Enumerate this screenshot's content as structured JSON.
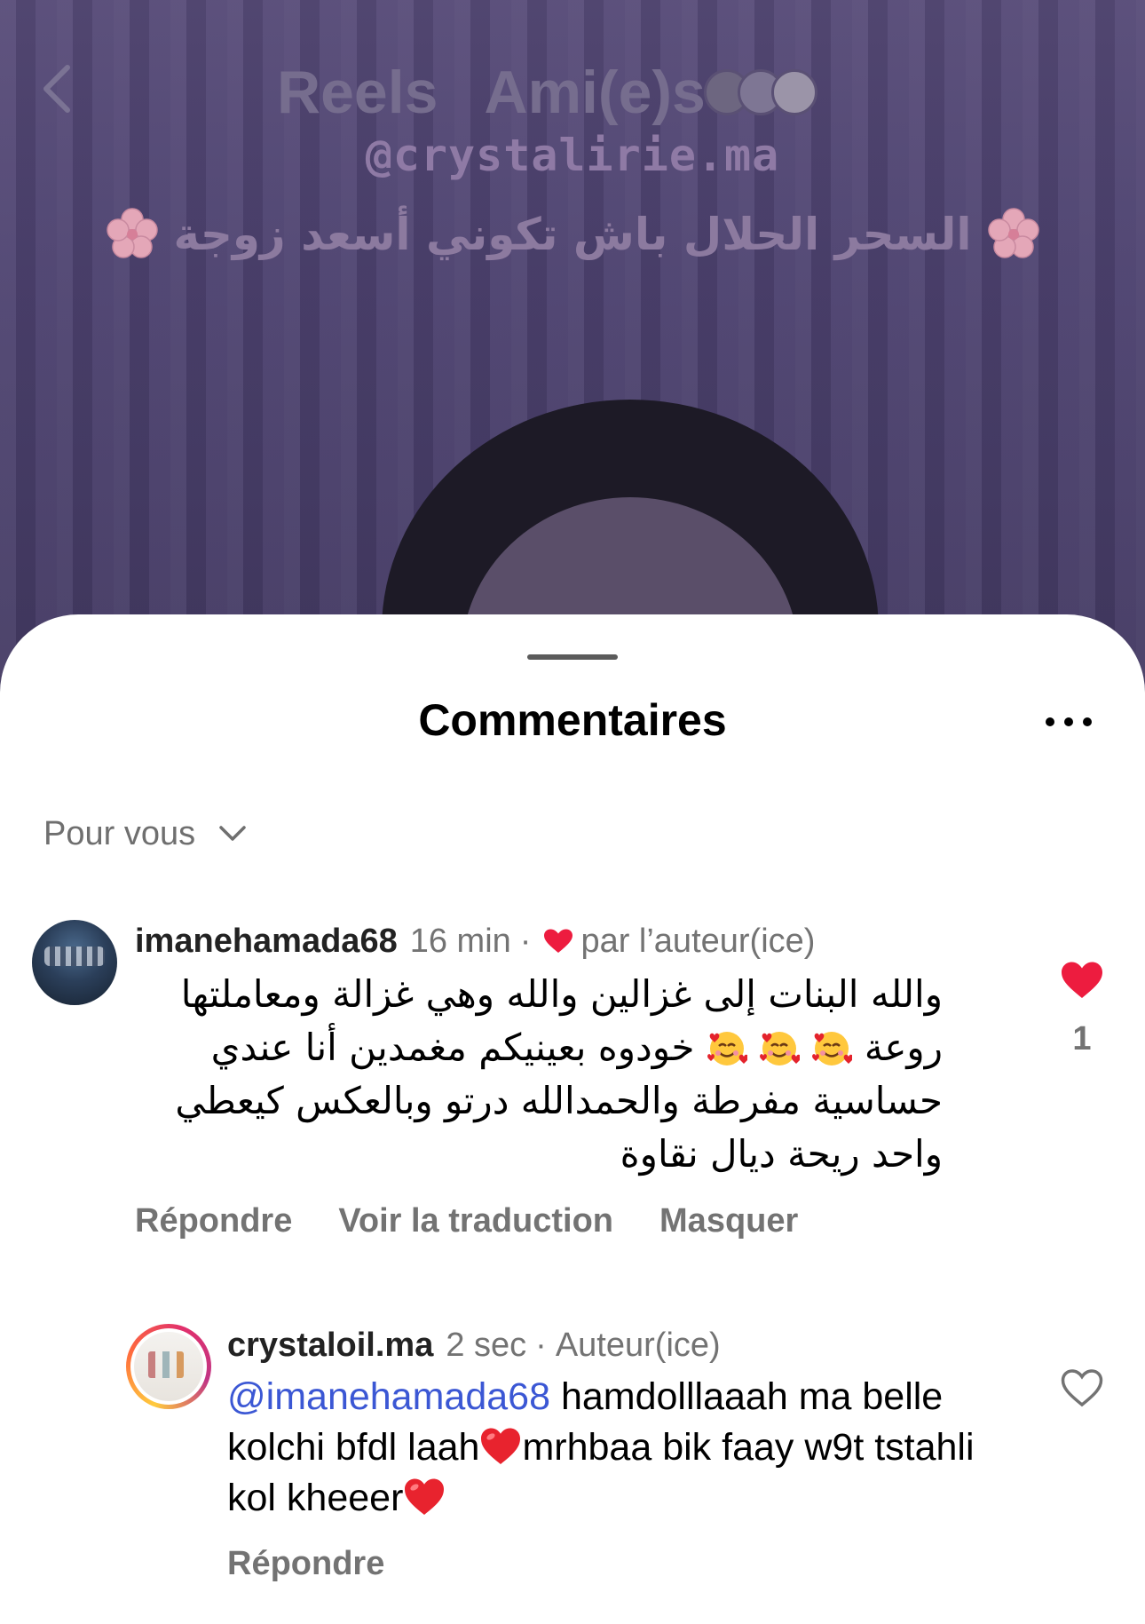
{
  "reel": {
    "tabs": [
      "Reels",
      "Ami(e)s"
    ],
    "overlay_handle": "@crystalirie.ma",
    "overlay_text": "السحر الحلال باش تكوني أسعد زوجة"
  },
  "sheet": {
    "title": "Commentaires",
    "filter_label": "Pour vous"
  },
  "comments": [
    {
      "username": "imanehamada68",
      "time": "16 min",
      "liked_by_author_label": "par l’auteur(ice)",
      "text_line1": "والله البنات إلى غزالين والله وهي غزالة ومعاملتها",
      "text_line2_start": "روعة",
      "text_line2_end": "خودوه بعينيكم مغمدين أنا عندي",
      "text_line3": "حساسية مفرطة والحمدالله درتو وبالعكس كيعطي",
      "text_line4": "واحد ريحة ديال نقاوة",
      "likes": "1",
      "actions": [
        "Répondre",
        "Voir la traduction",
        "Masquer"
      ]
    },
    {
      "username": "crystaloil.ma",
      "time": "2 sec",
      "role": "Auteur(ice)",
      "mention": "@imanehamada68",
      "text_part1": " hamdolllaaah ma belle kolchi bfdl laah",
      "text_part2": "mrhbaa bik faay w9t tstahli kol kheeer",
      "actions": [
        "Répondre"
      ]
    }
  ],
  "colors": {
    "accent_like": "#ed1c3f",
    "mention": "#3b57d4",
    "secondary_text": "#737373"
  }
}
